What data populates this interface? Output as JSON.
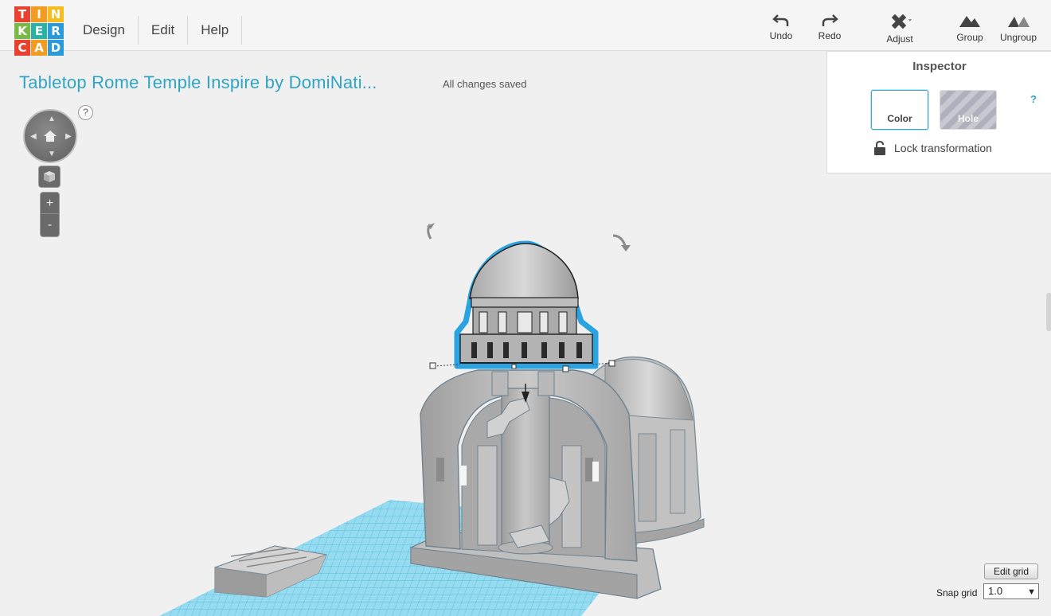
{
  "app": {
    "logo_letters": [
      "T",
      "I",
      "N",
      "K",
      "E",
      "R",
      "C",
      "A",
      "D"
    ],
    "logo_colors": [
      "#e8412f",
      "#f39c1f",
      "#f5bd1f",
      "#79b947",
      "#2ab2a7",
      "#2a9ad8",
      "#e8412f",
      "#f39c1f",
      "#2a9ad8"
    ]
  },
  "menu": {
    "design": "Design",
    "edit": "Edit",
    "help": "Help"
  },
  "toolbar": {
    "undo": "Undo",
    "redo": "Redo",
    "adjust": "Adjust",
    "group": "Group",
    "ungroup": "Ungroup"
  },
  "document": {
    "title": "Tabletop Rome Temple Inspire by DomiNati...",
    "save_status": "All changes saved"
  },
  "nav": {
    "help": "?",
    "zoom_in": "+",
    "zoom_out": "-"
  },
  "inspector": {
    "title": "Inspector",
    "help": "?",
    "color_label": "Color",
    "hole_label": "Hole",
    "lock_label": "Lock transformation"
  },
  "grid": {
    "edit_label": "Edit grid",
    "snap_label": "Snap grid",
    "snap_value": "1.0"
  },
  "colors": {
    "accent": "#2ea5c6",
    "workplane": "#6fd3f0",
    "selection": "#2aa3e0",
    "model": "#b9b9b9"
  }
}
